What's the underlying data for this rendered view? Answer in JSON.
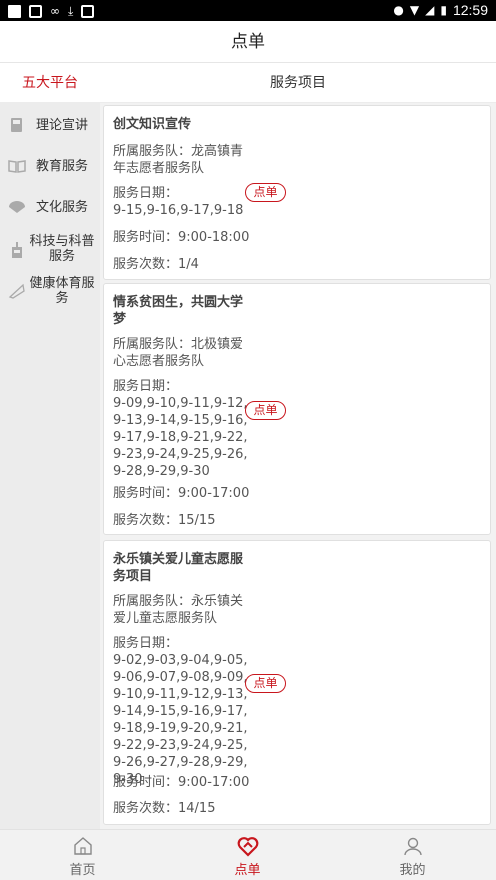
{
  "status_bar": {
    "time": "12:59"
  },
  "header": {
    "title": "点单"
  },
  "subheader": {
    "platform_label": "五大平台",
    "service_label": "服务项目"
  },
  "sidebar": {
    "items": [
      {
        "label": "理论宣讲",
        "icon": "book-icon"
      },
      {
        "label": "教育服务",
        "icon": "open-book-icon"
      },
      {
        "label": "文化服务",
        "icon": "fan-icon"
      },
      {
        "label": "科技与科普服务",
        "icon": "building-icon"
      },
      {
        "label": "健康体育服务",
        "icon": "megaphone-icon"
      }
    ]
  },
  "cards": [
    {
      "title": "创文知识宣传",
      "team": "所属服务队：龙高镇青年志愿者服务队",
      "dates_label": "服务日期：",
      "dates": "9-15,9-16,9-17,9-18",
      "time": "服务时间：9:00-18:00",
      "count": "服务次数：1/4",
      "order_label": "点单"
    },
    {
      "title": "情系贫困生，共圆大学梦",
      "team": "所属服务队：北极镇爱心志愿者服务队",
      "dates_label": "服务日期：",
      "dates": "9-09,9-10,9-11,9-12,9-13,9-14,9-15,9-16,9-17,9-18,9-21,9-22,9-23,9-24,9-25,9-26,9-28,9-29,9-30",
      "time": "服务时间：9:00-17:00",
      "count": "服务次数：15/15",
      "order_label": "点单"
    },
    {
      "title": "永乐镇关爱儿童志愿服务项目",
      "team": "所属服务队：永乐镇关爱儿童志愿服务队",
      "dates_label": "服务日期：",
      "dates": "9-02,9-03,9-04,9-05,9-06,9-07,9-08,9-09,9-10,9-11,9-12,9-13,9-14,9-15,9-16,9-17,9-18,9-19,9-20,9-21,9-22,9-23,9-24,9-25,9-26,9-27,9-28,9-29,9-30",
      "time": "服务时间：9:00-17:00",
      "count": "服务次数：14/15",
      "order_label": "点单"
    }
  ],
  "tabbar": {
    "items": [
      {
        "label": "首页",
        "icon": "home-icon"
      },
      {
        "label": "点单",
        "icon": "heart-order-icon",
        "active": true
      },
      {
        "label": "我的",
        "icon": "user-icon"
      }
    ]
  },
  "colors": {
    "accent": "#c8161d",
    "background": "#f2f2f2",
    "sidebar": "#ececec"
  }
}
